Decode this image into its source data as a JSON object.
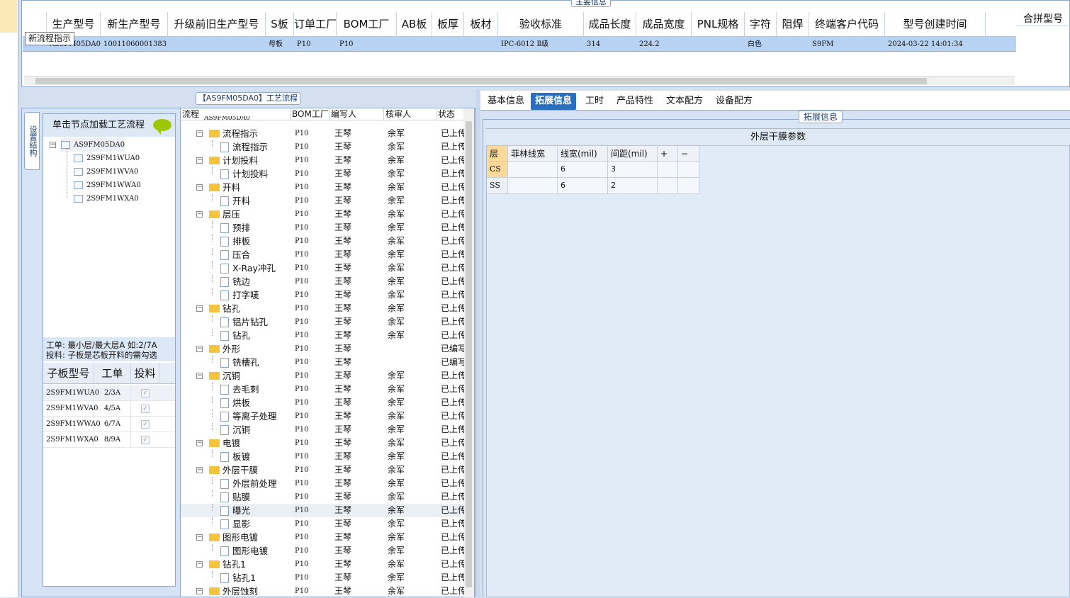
{
  "top_panel": {
    "title": "主要信息",
    "columns": [
      "生产型号",
      "新生产型号",
      "升级前旧生产型号",
      "S板",
      "订单工厂",
      "BOM工厂",
      "AB板",
      "板厚",
      "板材",
      "验收标准",
      "成品长度",
      "成品宽度",
      "PNL规格",
      "字符",
      "阻焊",
      "终端客户代码",
      "型号创建时间"
    ],
    "row": [
      "AS9FM05DA0",
      "10011060001383",
      "",
      "母板",
      "P10",
      "P10",
      "",
      "",
      "",
      "IPC-6012 Ⅱ级",
      "314",
      "224.2",
      "",
      "白色",
      "",
      "S9FM",
      "2024-03-22 14:01:34"
    ],
    "merge_header": "合拼型号",
    "tooltip": "新流程指示"
  },
  "flow_title": "【AS9FM05DA0】工艺流程",
  "structure_panel": {
    "vertical_tab": "设置结构",
    "header": "单击节点加载工艺流程",
    "root": "AS9FM05DA0",
    "children": [
      "2S9FM1WUA0",
      "2S9FM1WVA0",
      "2S9FM1WWA0",
      "2S9FM1WXA0"
    ],
    "note_line1": "工单: 最小层/最大层A 如:2/7A",
    "note_line2": "投料: 子板是芯板开料的需勾选",
    "sub_grid_headers": [
      "子板型号",
      "工单",
      "投料"
    ],
    "sub_rows": [
      {
        "model": "2S9FM1WUA0",
        "order": "2/3A",
        "checked": true
      },
      {
        "model": "2S9FM1WVA0",
        "order": "4/5A",
        "checked": true
      },
      {
        "model": "2S9FM1WWA0",
        "order": "6/7A",
        "checked": true
      },
      {
        "model": "2S9FM1WXA0",
        "order": "8/9A",
        "checked": true
      }
    ]
  },
  "flow_grid": {
    "headers": [
      "流程",
      "BOM工厂",
      "编写人",
      "核审人",
      "状态"
    ],
    "top_cut": "AS9FM05DA0",
    "rows": [
      {
        "name": "流程指示",
        "type": "folder",
        "bom": "P10",
        "writer": "王琴",
        "reviewer": "余军",
        "status": "已上传"
      },
      {
        "name": "流程指示",
        "type": "leaf",
        "bom": "P10",
        "writer": "王琴",
        "reviewer": "余军",
        "status": "已上传"
      },
      {
        "name": "计划投料",
        "type": "folder",
        "bom": "P10",
        "writer": "王琴",
        "reviewer": "余军",
        "status": "已上传"
      },
      {
        "name": "计划投料",
        "type": "leaf",
        "bom": "P10",
        "writer": "王琴",
        "reviewer": "余军",
        "status": "已上传"
      },
      {
        "name": "开料",
        "type": "folder",
        "bom": "P10",
        "writer": "王琴",
        "reviewer": "余军",
        "status": "已上传"
      },
      {
        "name": "开料",
        "type": "leaf",
        "bom": "P10",
        "writer": "王琴",
        "reviewer": "余军",
        "status": "已上传"
      },
      {
        "name": "层压",
        "type": "folder",
        "bom": "P10",
        "writer": "王琴",
        "reviewer": "余军",
        "status": "已上传"
      },
      {
        "name": "预排",
        "type": "leaf",
        "bom": "P10",
        "writer": "王琴",
        "reviewer": "余军",
        "status": "已上传"
      },
      {
        "name": "排板",
        "type": "leaf",
        "bom": "P10",
        "writer": "王琴",
        "reviewer": "余军",
        "status": "已上传"
      },
      {
        "name": "压合",
        "type": "leaf",
        "bom": "P10",
        "writer": "王琴",
        "reviewer": "余军",
        "status": "已上传"
      },
      {
        "name": "X-Ray冲孔",
        "type": "leaf",
        "bom": "P10",
        "writer": "王琴",
        "reviewer": "余军",
        "status": "已上传"
      },
      {
        "name": "铣边",
        "type": "leaf",
        "bom": "P10",
        "writer": "王琴",
        "reviewer": "余军",
        "status": "已上传"
      },
      {
        "name": "打字唛",
        "type": "leaf",
        "bom": "P10",
        "writer": "王琴",
        "reviewer": "余军",
        "status": "已上传"
      },
      {
        "name": "钻孔",
        "type": "folder",
        "bom": "P10",
        "writer": "王琴",
        "reviewer": "余军",
        "status": "已上传"
      },
      {
        "name": "铝片钻孔",
        "type": "leaf",
        "bom": "P10",
        "writer": "王琴",
        "reviewer": "余军",
        "status": "已上传"
      },
      {
        "name": "钻孔",
        "type": "leaf",
        "bom": "P10",
        "writer": "王琴",
        "reviewer": "余军",
        "status": "已上传"
      },
      {
        "name": "外形",
        "type": "folder",
        "bom": "P10",
        "writer": "王琴",
        "reviewer": "",
        "status": "已编写"
      },
      {
        "name": "铣槽孔",
        "type": "leaf",
        "bom": "P10",
        "writer": "王琴",
        "reviewer": "",
        "status": "已编写"
      },
      {
        "name": "沉铜",
        "type": "folder",
        "bom": "P10",
        "writer": "王琴",
        "reviewer": "余军",
        "status": "已上传"
      },
      {
        "name": "去毛刺",
        "type": "leaf",
        "bom": "P10",
        "writer": "王琴",
        "reviewer": "余军",
        "status": "已上传"
      },
      {
        "name": "烘板",
        "type": "leaf",
        "bom": "P10",
        "writer": "王琴",
        "reviewer": "余军",
        "status": "已上传"
      },
      {
        "name": "等离子处理",
        "type": "leaf",
        "bom": "P10",
        "writer": "王琴",
        "reviewer": "余军",
        "status": "已上传"
      },
      {
        "name": "沉铜",
        "type": "leaf",
        "bom": "P10",
        "writer": "王琴",
        "reviewer": "余军",
        "status": "已上传"
      },
      {
        "name": "电镀",
        "type": "folder",
        "bom": "P10",
        "writer": "王琴",
        "reviewer": "余军",
        "status": "已上传"
      },
      {
        "name": "板镀",
        "type": "leaf",
        "bom": "P10",
        "writer": "王琴",
        "reviewer": "余军",
        "status": "已上传"
      },
      {
        "name": "外层干膜",
        "type": "folder",
        "bom": "P10",
        "writer": "王琴",
        "reviewer": "余军",
        "status": "已上传"
      },
      {
        "name": "外层前处理",
        "type": "leaf",
        "bom": "P10",
        "writer": "王琴",
        "reviewer": "余军",
        "status": "已上传"
      },
      {
        "name": "贴膜",
        "type": "leaf",
        "bom": "P10",
        "writer": "王琴",
        "reviewer": "余军",
        "status": "已上传"
      },
      {
        "name": "曝光",
        "type": "leaf",
        "bom": "P10",
        "writer": "王琴",
        "reviewer": "余军",
        "status": "已上传",
        "selected": true
      },
      {
        "name": "显影",
        "type": "leaf",
        "bom": "P10",
        "writer": "王琴",
        "reviewer": "余军",
        "status": "已上传"
      },
      {
        "name": "图形电镀",
        "type": "folder",
        "bom": "P10",
        "writer": "王琴",
        "reviewer": "余军",
        "status": "已上传"
      },
      {
        "name": "图形电镀",
        "type": "leaf",
        "bom": "P10",
        "writer": "王琴",
        "reviewer": "余军",
        "status": "已上传"
      },
      {
        "name": "钻孔1",
        "type": "folder",
        "bom": "P10",
        "writer": "王琴",
        "reviewer": "余军",
        "status": "已上传"
      },
      {
        "name": "钻孔1",
        "type": "leaf",
        "bom": "P10",
        "writer": "王琴",
        "reviewer": "余军",
        "status": "已上传"
      },
      {
        "name": "外层蚀刻",
        "type": "folder",
        "bom": "P10",
        "writer": "王琴",
        "reviewer": "余军",
        "status": "已上传"
      }
    ]
  },
  "right_tabs": [
    "基本信息",
    "拓展信息",
    "工时",
    "产品特性",
    "文本配方",
    "设备配方"
  ],
  "active_tab": "拓展信息",
  "ext_title": "拓展信息",
  "film_table": {
    "title": "外层干膜参数",
    "headers": [
      "层",
      "菲林线宽",
      "线宽(mil)",
      "间距(mil)",
      "+",
      "−"
    ],
    "rows": [
      [
        "CS",
        "",
        "6",
        "3",
        "",
        ""
      ],
      [
        "SS",
        "",
        "6",
        "2",
        "",
        ""
      ]
    ]
  },
  "colors": {
    "accent": "#2a6ec0",
    "selected_row": "#b8d2f4",
    "folder": "#f5c43d",
    "bubble": "#9cc600"
  }
}
